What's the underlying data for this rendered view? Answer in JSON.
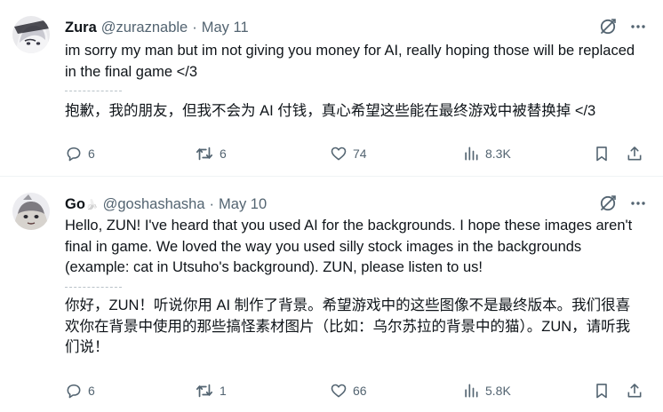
{
  "tweets": [
    {
      "name": "Zura",
      "handle": "@zuraznable",
      "separator": "·",
      "date": "May 11",
      "text": "im sorry my man but im not giving you money for AI, really hoping those will be replaced in the final game </3",
      "translation": "抱歉，我的朋友，但我不会为 AI 付钱，真心希望这些能在最终游戏中被替换掉 </3",
      "replies": "6",
      "retweets": "6",
      "likes": "74",
      "views": "8.3K"
    },
    {
      "name": "Go",
      "name_badge": "🍌",
      "handle": "@goshashasha",
      "separator": "·",
      "date": "May 10",
      "text": "Hello, ZUN! I've heard that you used AI for the backgrounds. I hope these images aren't final in game. We loved the way you used silly stock images in the backgrounds (example: cat in Utsuho's background). ZUN, please listen to us!",
      "translation": "你好，ZUN！听说你用 AI 制作了背景。希望游戏中的这些图像不是最终版本。我们很喜欢你在背景中使用的那些搞怪素材图片（比如：乌尔苏拉的背景中的猫）。ZUN，请听我们说！",
      "replies": "6",
      "retweets": "1",
      "likes": "66",
      "views": "5.8K"
    }
  ],
  "icons": {
    "grok": "grok-icon",
    "more": "more-icon",
    "reply": "reply-icon",
    "retweet": "retweet-icon",
    "like": "heart-icon",
    "views": "views-icon",
    "bookmark": "bookmark-icon",
    "share": "share-icon"
  },
  "colors": {
    "text": "#0f1419",
    "muted": "#536471",
    "divider": "#eff3f4"
  }
}
